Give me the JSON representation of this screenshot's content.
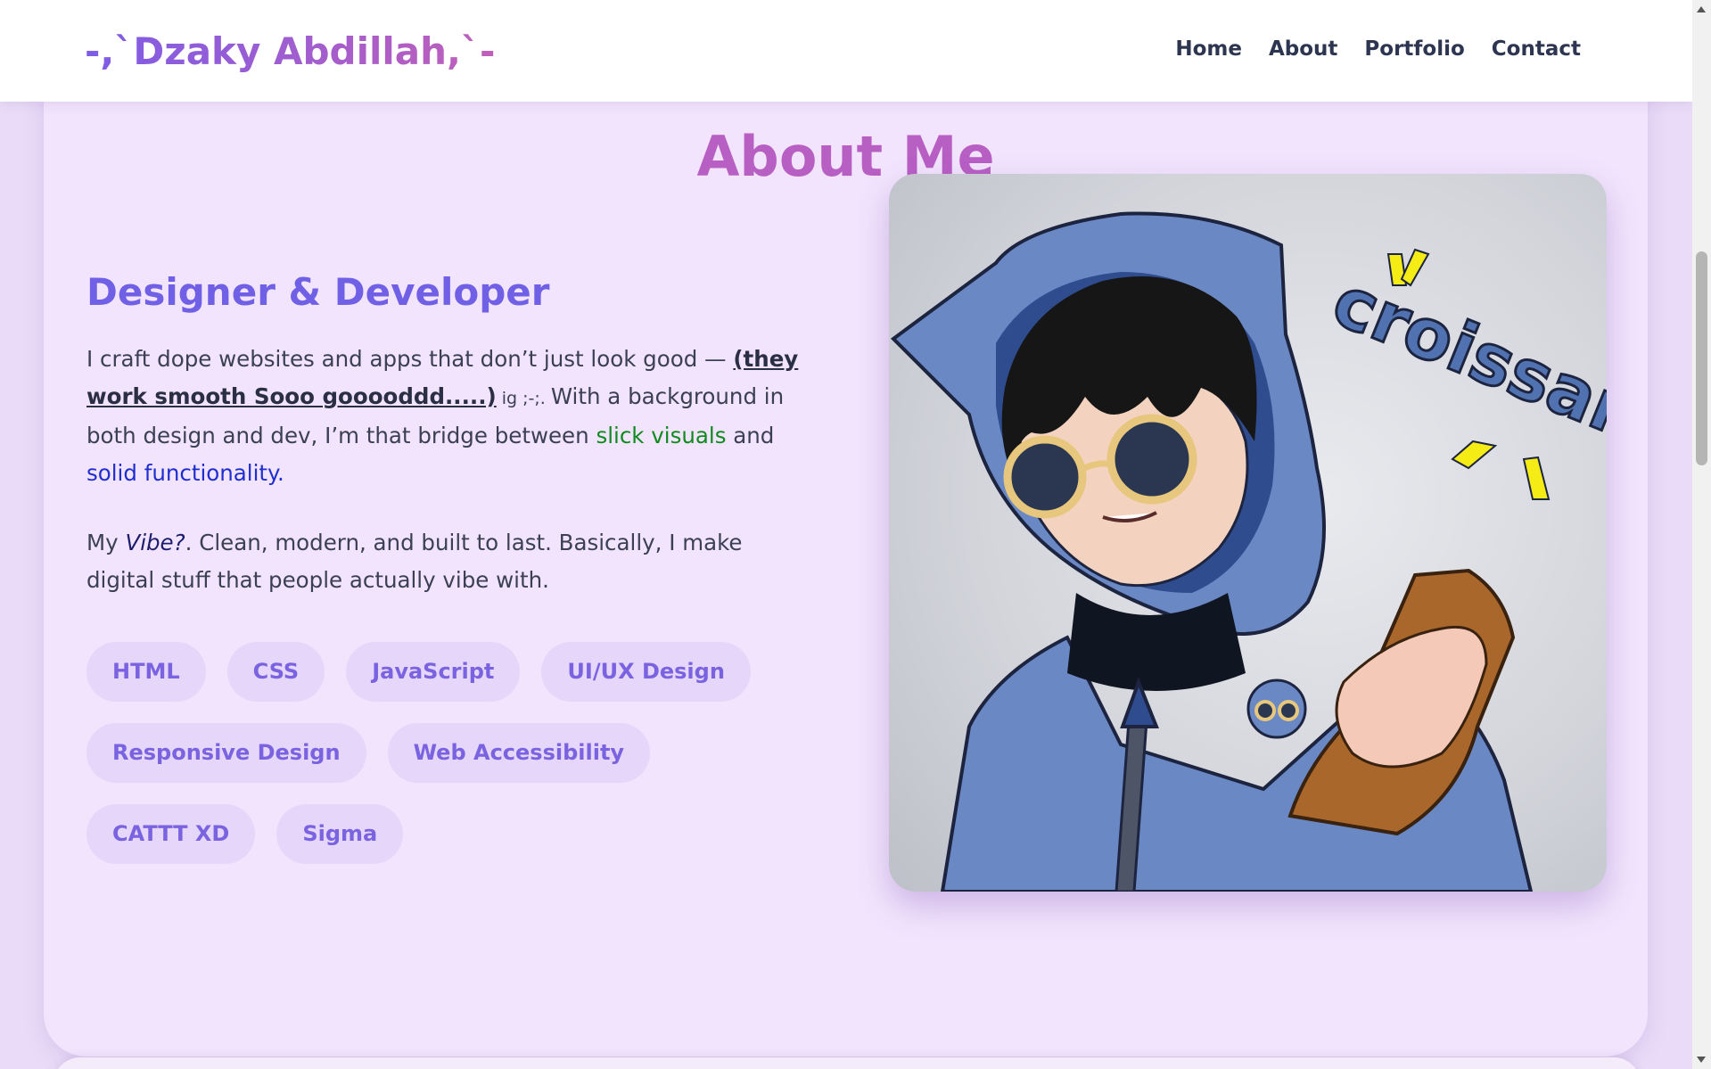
{
  "header": {
    "logo": "-,`Dzaky Abdillah,`-",
    "nav": [
      "Home",
      "About",
      "Portfolio",
      "Contact"
    ]
  },
  "about": {
    "title": "About Me",
    "subtitle": "Designer & Developer",
    "para1": {
      "t1": "I craft dope websites and apps that don’t just look good — ",
      "emph": "(they work smooth Sooo gooooddd.....)",
      "small": " ig ;-;. ",
      "t2": "With a background in both design and dev, I’m that bridge between ",
      "green": "slick visuals",
      "t3": " and ",
      "blue": "solid functionality."
    },
    "para2": {
      "t1": "My ",
      "vibe": "Vibe?",
      "t2": ". Clean, modern, and built to last. Basically, I make digital stuff that people actually vibe with."
    },
    "skills": [
      "HTML",
      "CSS",
      "JavaScript",
      "UI/UX Design",
      "Responsive Design",
      "Web Accessibility",
      "CATTT XD",
      "Sigma"
    ],
    "artwork": {
      "caption_text": "croissant",
      "colors": {
        "hoodie": "#6a88c4",
        "hair": "#161616",
        "croissant": "#a9672c",
        "spark": "#f5ec16"
      }
    }
  },
  "colors": {
    "accent_purple": "#7060e6",
    "title_pink": "#b85fc4",
    "card_bg": "#f2e4fd",
    "tag_bg": "#e6d6fa"
  }
}
